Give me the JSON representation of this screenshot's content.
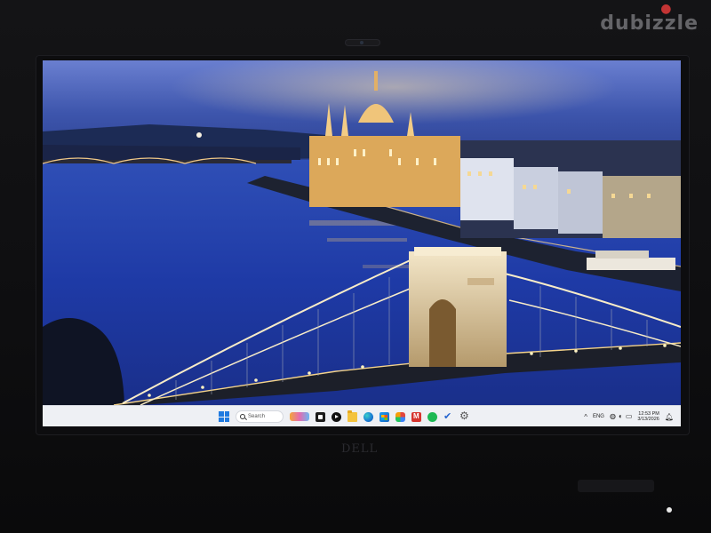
{
  "watermark": {
    "text": "dubizzle"
  },
  "device": {
    "brand": "DELL"
  },
  "wallpaper": {
    "subject": "Budapest Parliament and Chain Bridge at dusk"
  },
  "taskbar": {
    "start_icon": "windows-start-icon",
    "search": {
      "placeholder": "Search"
    },
    "pinned_apps": [
      {
        "name": "widgets-icon"
      },
      {
        "name": "task-view-icon"
      },
      {
        "name": "media-player-icon"
      },
      {
        "name": "file-explorer-icon"
      },
      {
        "name": "edge-browser-icon"
      },
      {
        "name": "microsoft-store-icon"
      },
      {
        "name": "copilot-icon"
      },
      {
        "name": "office-icon"
      },
      {
        "name": "spotify-icon"
      },
      {
        "name": "todo-icon"
      },
      {
        "name": "settings-icon"
      }
    ],
    "tray": {
      "chevron": "^",
      "language": "ENG",
      "icons": [
        "network-icon",
        "volume-icon",
        "battery-icon"
      ],
      "time": "12:53 PM",
      "date": "3/13/2026",
      "notification_icon": "bell-icon"
    }
  },
  "colors": {
    "sky": "#3b4fa8",
    "water": "#1f3aa0",
    "taskbar": "#eef0f4",
    "accent": "#1f7ae0"
  }
}
